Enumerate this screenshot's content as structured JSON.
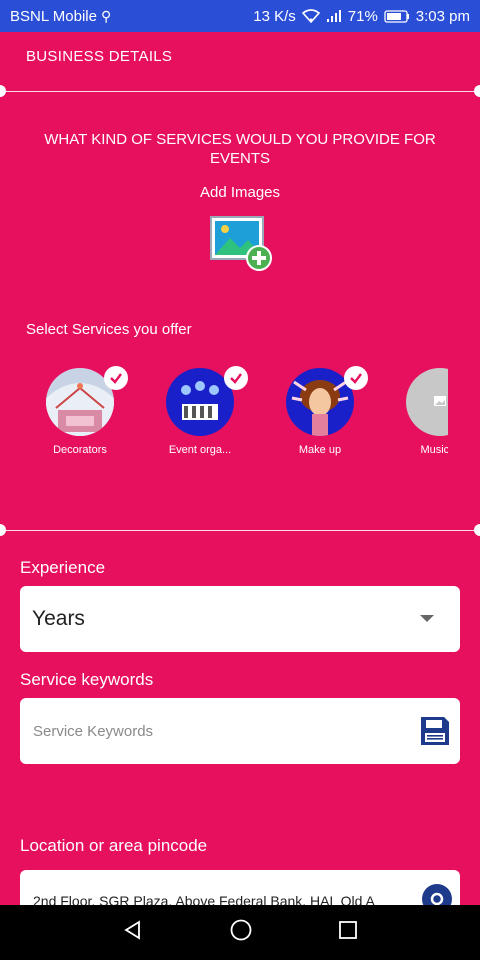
{
  "status_bar": {
    "carrier": "BSNL Mobile",
    "speed": "13 K/s",
    "battery": "71%",
    "time": "3:03 pm",
    "icons": [
      "usb-icon",
      "wifi-icon",
      "signal-icon",
      "battery-icon"
    ]
  },
  "header": {
    "title": "BUSINESS DETAILS"
  },
  "question": "WHAT KIND OF SERVICES WOULD YOU PROVIDE FOR EVENTS",
  "add_images": {
    "label": "Add Images",
    "icon": "add-image-icon"
  },
  "services": {
    "label": "Select Services you offer",
    "items": [
      {
        "name": "Decorators",
        "selected": true
      },
      {
        "name": "Event orga...",
        "selected": true
      },
      {
        "name": "Make up",
        "selected": true
      },
      {
        "name": "Music &",
        "selected": false
      }
    ]
  },
  "experience": {
    "label": "Experience",
    "value": "Years"
  },
  "keywords": {
    "label": "Service keywords",
    "placeholder": "Service Keywords",
    "icon": "save-icon"
  },
  "location": {
    "label": "Location or area pincode",
    "value": "2nd Floor, SGR Plaza, Above Federal Bank, HAL Old A",
    "icon": "location-pin-icon"
  },
  "colors": {
    "primary": "#E6105E",
    "status_bar": "#2A4FD6",
    "icon_blue": "#1E3A8A"
  },
  "nav": {
    "icons": [
      "back-icon",
      "home-icon",
      "recents-icon"
    ]
  }
}
